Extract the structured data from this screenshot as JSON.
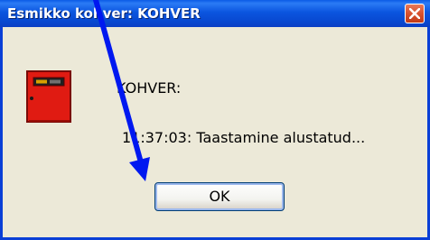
{
  "window": {
    "title": "Esmikko kohver: KOHVER"
  },
  "dialog": {
    "icon": "red-control-panel-icon",
    "name_line": "KOHVER:",
    "status_line": "11:37:03: Taastamine alustatud...",
    "ok_label": "OK"
  },
  "annotation": {
    "arrow_color": "#0018f0"
  },
  "colors": {
    "titlebar": "#0b55df",
    "dialog_background": "#ece9d8",
    "close_button": "#d8512e",
    "device_red": "#e01b12"
  }
}
